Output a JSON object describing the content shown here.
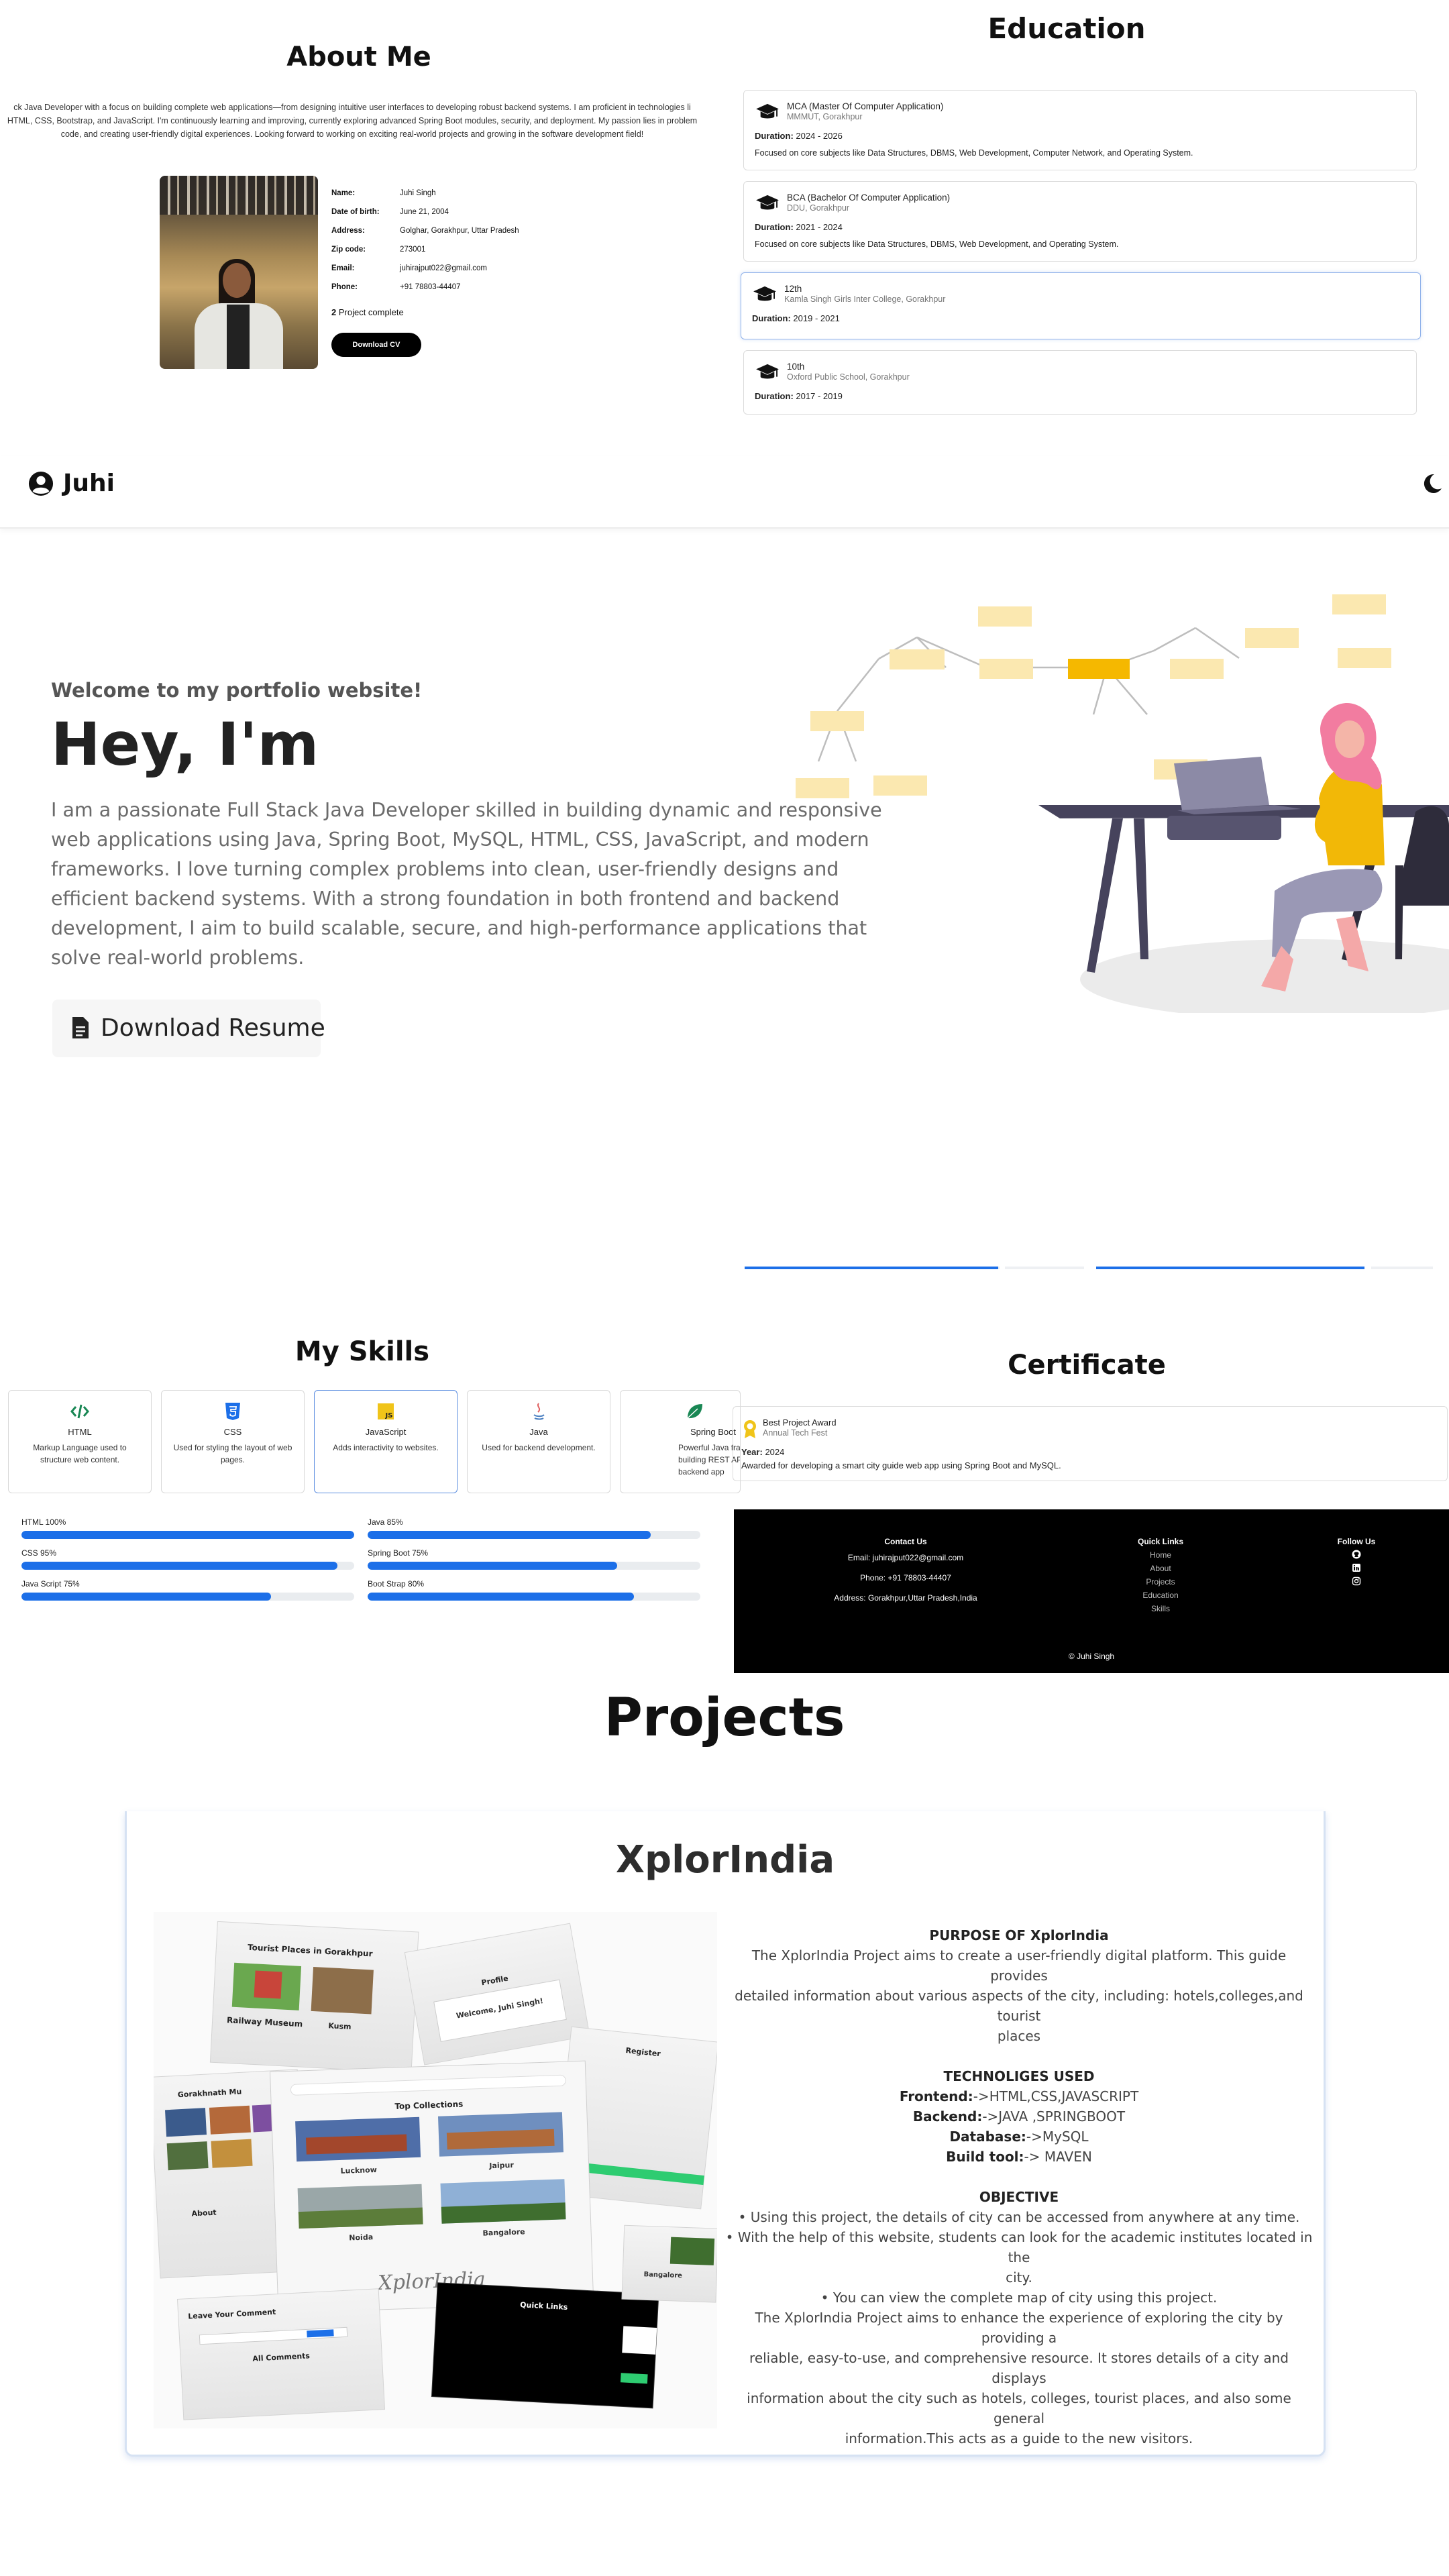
{
  "about": {
    "title": "About Me",
    "description_lines": [
      "ck Java Developer with a focus on building complete web applications—from designing intuitive user interfaces to developing robust backend systems. I am proficient in technologies li",
      "HTML, CSS, Bootstrap, and JavaScript. I'm continuously learning and improving, currently exploring advanced Spring Boot modules, security, and deployment. My passion lies in problem",
      "code, and creating user-friendly digital experiences. Looking forward to working on exciting real-world projects and growing in the software development field!"
    ],
    "info": [
      {
        "key": "Name:",
        "value": "Juhi Singh"
      },
      {
        "key": "Date of birth:",
        "value": "June 21, 2004"
      },
      {
        "key": "Address:",
        "value": "Golghar, Gorakhpur, Uttar Pradesh"
      },
      {
        "key": "Zip code:",
        "value": "273001"
      },
      {
        "key": "Email:",
        "value": "juhirajput022@gmail.com"
      },
      {
        "key": "Phone:",
        "value": "+91 78803-44407"
      }
    ],
    "project_count": "2",
    "project_label": "Project complete",
    "download_cv_label": "Download CV"
  },
  "education": {
    "title": "Education",
    "duration_label": "Duration:",
    "items": [
      {
        "degree": "MCA (Master Of Computer Application)",
        "institute": "MMMUT, Gorakhpur",
        "duration": "2024 - 2026",
        "description": "Focused on core subjects like Data Structures, DBMS, Web Development, Computer Network, and Operating System."
      },
      {
        "degree": "BCA (Bachelor Of Computer Application)",
        "institute": "DDU, Gorakhpur",
        "duration": "2021 - 2024",
        "description": "Focused on core subjects like Data Structures, DBMS, Web Development, and Operating System."
      },
      {
        "degree": "12th",
        "institute": "Kamla Singh Girls Inter College, Gorakhpur",
        "duration": "2019 - 2021",
        "description": ""
      },
      {
        "degree": "10th",
        "institute": "Oxford Public School, Gorakhpur",
        "duration": "2017 - 2019",
        "description": ""
      }
    ]
  },
  "nav": {
    "brand": "Juhi"
  },
  "hero": {
    "welcome": "Welcome to my portfolio website!",
    "heading": "Hey, I'm",
    "paragraph_lines": [
      "I am a passionate Full Stack Java Developer skilled in building dynamic and responsive",
      "web applications using Java, Spring Boot, MySQL, HTML, CSS, JavaScript, and modern",
      "frameworks. I love turning complex problems into clean, user-friendly designs and",
      "efficient backend systems. With a strong foundation in both frontend and backend",
      "development, I aim to build scalable, secure, and high-performance applications that",
      "solve real-world problems."
    ],
    "download_resume_label": "Download Resume"
  },
  "skills": {
    "title": "My Skills",
    "cards": [
      {
        "name": "HTML",
        "description": "Markup Language used to structure web content.",
        "icon": "code-icon",
        "color": "#198754"
      },
      {
        "name": "CSS",
        "description": "Used for styling the layout of web pages.",
        "icon": "css3-icon",
        "color": "#1c6fe8"
      },
      {
        "name": "JavaScript",
        "description": "Adds interactivity to websites.",
        "icon": "javascript-icon",
        "color": "#f0c419"
      },
      {
        "name": "Java",
        "description": "Used for backend development.",
        "icon": "java-icon",
        "color": "#e06060"
      },
      {
        "name": "Spring Boot",
        "description": "Powerful Java frame building REST AP backend app",
        "icon": "leaf-icon",
        "color": "#198754"
      }
    ],
    "bars": [
      {
        "label": "HTML 100%",
        "percent": 100
      },
      {
        "label": "Java 85%",
        "percent": 85
      },
      {
        "label": "CSS 95%",
        "percent": 95
      },
      {
        "label": "Spring Boot 75%",
        "percent": 75
      },
      {
        "label": "Java Script 75%",
        "percent": 75
      },
      {
        "label": "Boot Strap 80%",
        "percent": 80
      }
    ],
    "accent_color": "#1c6fe8"
  },
  "certificate": {
    "title": "Certificate",
    "name": "Best Project Award",
    "issuer": "Annual Tech Fest",
    "year_label": "Year:",
    "year": "2024",
    "description": "Awarded for developing a smart city guide web app using Spring Boot and MySQL."
  },
  "footer": {
    "contact_title": "Contact Us",
    "email": "Email: juhirajput022@gmail.com",
    "phone": "Phone: +91 78803-44407",
    "address": "Address: Gorakhpur,Uttar Pradesh,India",
    "links_title": "Quick Links",
    "links": [
      "Home",
      "About",
      "Projects",
      "Education",
      "Skills"
    ],
    "follow_title": "Follow Us",
    "social_icons": [
      "github-icon",
      "linkedin-icon",
      "instagram-icon"
    ],
    "copyright": "© Juhi Singh"
  },
  "projects": {
    "title": "Projects",
    "name": "XplorIndia",
    "purpose_title": "PURPOSE OF XplorIndia",
    "purpose_lines": [
      "The XplorIndia Project aims to create a user-friendly digital platform. This guide provides",
      "detailed information about various aspects of the city, including: hotels,colleges,and tourist",
      "places"
    ],
    "tech_title": "TECHNOLIGES USED",
    "tech": [
      {
        "label": "Frontend:",
        "value": "->HTML,CSS,JAVASCRIPT"
      },
      {
        "label": "Backend:",
        "value": "->JAVA ,SPRINGBOOT"
      },
      {
        "label": "Database:",
        "value": "->MySQL"
      },
      {
        "label": "Build tool:",
        "value": "-> MAVEN"
      }
    ],
    "objective_title": "OBJECTIVE",
    "objective_lines": [
      "• Using this project, the details of city can be accessed from anywhere at any time.",
      "• With the help of this website, students can look for the academic institutes located in the",
      "city.",
      "• You can view the complete map of city using this project.",
      "The XplorIndia Project aims to enhance the experience of exploring the city by providing a",
      "reliable, easy-to-use, and comprehensive resource. It stores details of a city and displays",
      "information about the city such as hotels, colleges, tourist places, and also some general",
      "information.This acts as a guide to the new visitors."
    ],
    "screenshot_texts": {
      "page_title": "Tourist Places in Gorakhpur",
      "railway": "Railway Museum",
      "kusmi": "Kusm",
      "profile": "Profile",
      "welcome": "Welcome, Juhi Singh!",
      "register": "Register",
      "museum": "Gorakhnath Mu",
      "top_collections": "Top Collections",
      "lucknow": "Lucknow",
      "jaipur": "Jaipur",
      "noida": "Noida",
      "bangalore": "Bangalore",
      "about": "About",
      "signature": "XplorIndia",
      "leave_comment": "Leave Your Comment",
      "all_comments": "All Comments",
      "quick_links": "Quick Links",
      "bangalore2": "Bangalore"
    }
  }
}
